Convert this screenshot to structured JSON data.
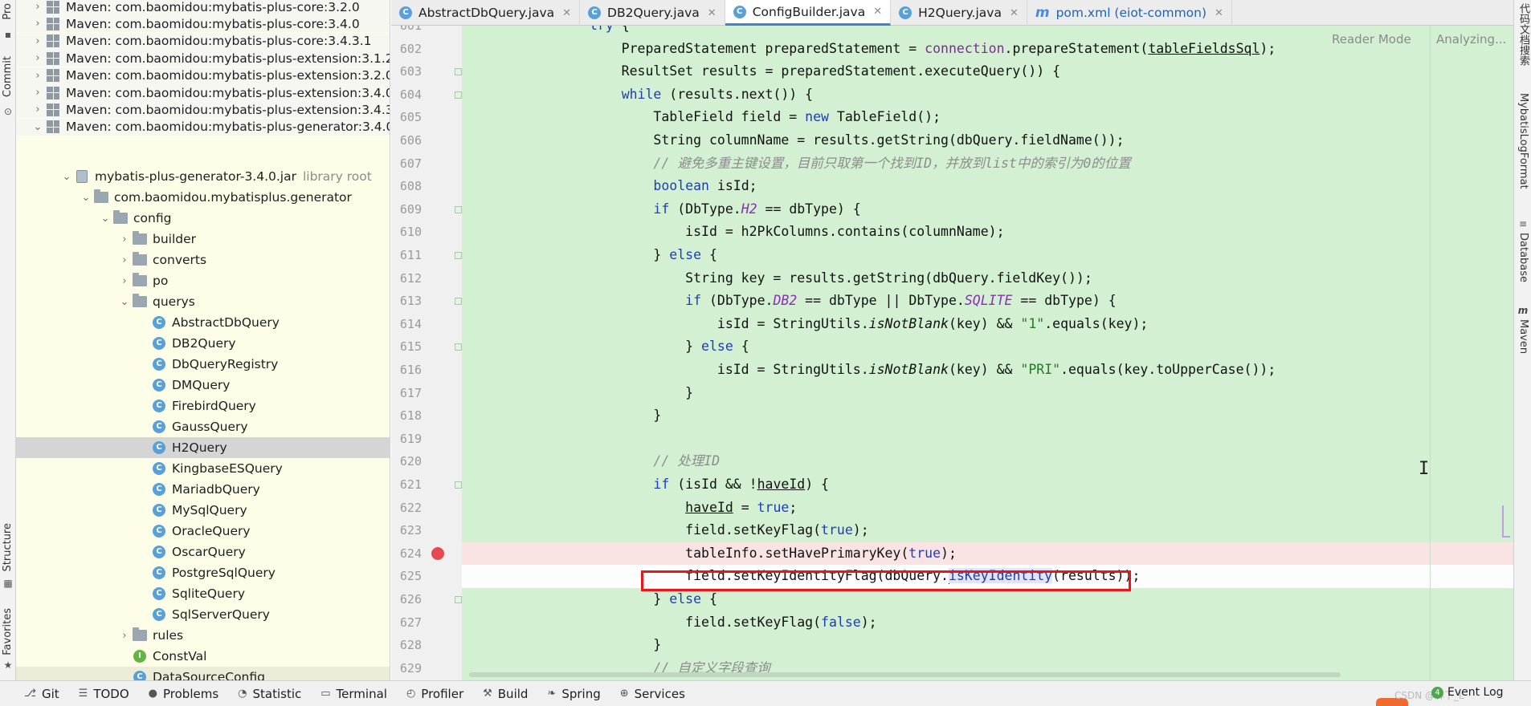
{
  "left_strip": {
    "tabs": [
      "Pro",
      "Commit",
      "Structure",
      "Favorites"
    ]
  },
  "project_tree": {
    "maven_libs": [
      "Maven: com.baomidou:mybatis-plus-core:3.2.0",
      "Maven: com.baomidou:mybatis-plus-core:3.4.0",
      "Maven: com.baomidou:mybatis-plus-core:3.4.3.1",
      "Maven: com.baomidou:mybatis-plus-extension:3.1.2",
      "Maven: com.baomidou:mybatis-plus-extension:3.2.0",
      "Maven: com.baomidou:mybatis-plus-extension:3.4.0",
      "Maven: com.baomidou:mybatis-plus-extension:3.4.3.",
      "Maven: com.baomidou:mybatis-plus-generator:3.4.0"
    ],
    "jar": "mybatis-plus-generator-3.4.0.jar",
    "jar_hint": "library root",
    "package": "com.baomidou.mybatisplus.generator",
    "config_folder": "config",
    "subfolders": [
      "builder",
      "converts",
      "po"
    ],
    "querys_folder": "querys",
    "classes": [
      "AbstractDbQuery",
      "DB2Query",
      "DbQueryRegistry",
      "DMQuery",
      "FirebirdQuery",
      "GaussQuery",
      "H2Query",
      "KingbaseESQuery",
      "MariadbQuery",
      "MySqlQuery",
      "OracleQuery",
      "OscarQuery",
      "PostgreSqlQuery",
      "SqliteQuery",
      "SqlServerQuery"
    ],
    "selected": "H2Query",
    "rules_folder": "rules",
    "const_val": "ConstVal",
    "datasource_config": "DataSourceConfig"
  },
  "tabs": [
    {
      "label": "AbstractDbQuery.java",
      "icon": "class-icon"
    },
    {
      "label": "DB2Query.java",
      "icon": "class-icon"
    },
    {
      "label": "ConfigBuilder.java",
      "icon": "class-icon",
      "active": true
    },
    {
      "label": "H2Query.java",
      "icon": "class-icon"
    },
    {
      "label": "pom.xml (eiot-common)",
      "icon": "maven-icon"
    }
  ],
  "editor": {
    "reader_mode": "Reader Mode",
    "analyzing": "Analyzing...",
    "line_numbers": [
      "601",
      "602",
      "603",
      "604",
      "605",
      "606",
      "607",
      "608",
      "609",
      "610",
      "611",
      "612",
      "613",
      "614",
      "615",
      "616",
      "617",
      "618",
      "619",
      "620",
      "621",
      "622",
      "623",
      "624",
      "625",
      "626",
      "627",
      "628",
      "629"
    ],
    "breakpoint_line": "624",
    "highlighted_line": "625"
  },
  "right_strip": {
    "tabs": [
      "代码文档搜索",
      "MybatisLogFormat",
      "Database",
      "Maven"
    ]
  },
  "bottom_bar": {
    "items": [
      "Git",
      "TODO",
      "Problems",
      "Statistic",
      "Terminal",
      "Profiler",
      "Build",
      "Spring",
      "Services"
    ],
    "event_log": "Event Log",
    "event_count": "4",
    "watermark": "CSDN @林下_L"
  }
}
